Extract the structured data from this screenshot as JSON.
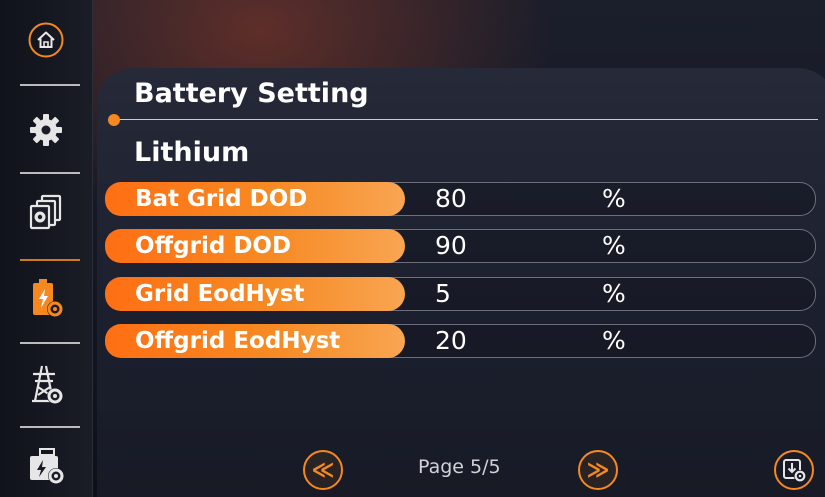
{
  "header": {
    "title": "Battery Setting",
    "subtitle": "Lithium"
  },
  "settings": [
    {
      "label": "Bat Grid DOD",
      "value": "80",
      "unit": "%"
    },
    {
      "label": "Offgrid DOD",
      "value": "90",
      "unit": "%"
    },
    {
      "label": "Grid EodHyst",
      "value": "5",
      "unit": "%"
    },
    {
      "label": "Offgrid EodHyst",
      "value": "20",
      "unit": "%"
    }
  ],
  "footer": {
    "prev_glyph": "≪",
    "next_glyph": "≫",
    "page_label": "Page 5/5"
  },
  "sidebar": {
    "items": [
      {
        "icon": "home-icon"
      },
      {
        "icon": "gear-icon"
      },
      {
        "icon": "pages-settings-icon"
      },
      {
        "icon": "battery-settings-icon"
      },
      {
        "icon": "grid-tower-settings-icon"
      },
      {
        "icon": "generator-settings-icon"
      }
    ]
  },
  "colors": {
    "accent": "#f5891f",
    "label_gradient_start": "#ff6f13",
    "background": "#141722"
  }
}
